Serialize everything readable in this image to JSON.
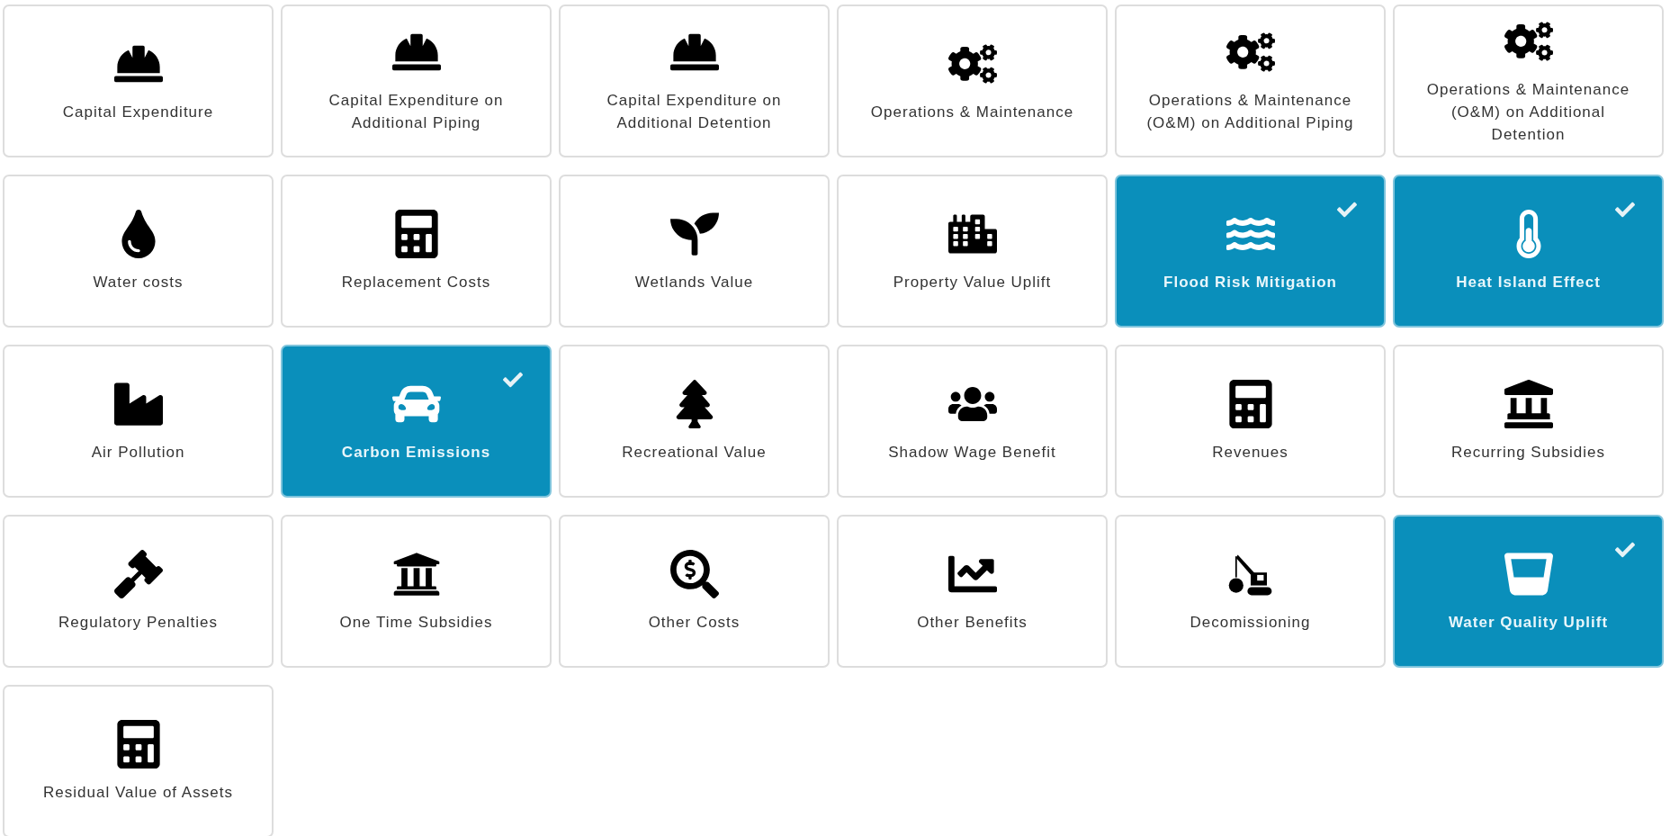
{
  "tiles": [
    {
      "label": "Capital Expenditure",
      "kind": "worker",
      "selected": false
    },
    {
      "label": "Capital Expenditure on Additional Piping",
      "kind": "worker",
      "selected": false
    },
    {
      "label": "Capital Expenditure on Additional Detention",
      "kind": "worker",
      "selected": false
    },
    {
      "label": "Operations & Maintenance",
      "kind": "maintenance",
      "selected": false
    },
    {
      "label": "Operations & Maintenance (O&M) on Additional Piping",
      "kind": "maintenance",
      "selected": false
    },
    {
      "label": "Operations & Maintenance (O&M) on Additional Detention",
      "kind": "maintenance",
      "selected": false
    },
    {
      "label": "Water costs",
      "kind": "drop",
      "selected": false
    },
    {
      "label": "Replacement Costs",
      "kind": "calculator",
      "selected": false
    },
    {
      "label": "Wetlands Value",
      "kind": "wetland",
      "selected": false
    },
    {
      "label": "Property Value Uplift",
      "kind": "buildings",
      "selected": false
    },
    {
      "label": "Flood Risk Mitigation",
      "kind": "flood",
      "selected": true
    },
    {
      "label": "Heat Island Effect",
      "kind": "thermometer",
      "selected": true
    },
    {
      "label": "Air Pollution",
      "kind": "factory",
      "selected": false
    },
    {
      "label": "Carbon Emissions",
      "kind": "car",
      "selected": true
    },
    {
      "label": "Recreational Value",
      "kind": "park",
      "selected": false
    },
    {
      "label": "Shadow Wage Benefit",
      "kind": "people",
      "selected": false
    },
    {
      "label": "Revenues",
      "kind": "calculator",
      "selected": false
    },
    {
      "label": "Recurring Subsidies",
      "kind": "landmark",
      "selected": false
    },
    {
      "label": "Regulatory Penalties",
      "kind": "gavel",
      "selected": false
    },
    {
      "label": "One Time Subsidies",
      "kind": "bank",
      "selected": false
    },
    {
      "label": "Other Costs",
      "kind": "costs",
      "selected": false
    },
    {
      "label": "Other Benefits",
      "kind": "chart",
      "selected": false
    },
    {
      "label": "Decomissioning",
      "kind": "crane",
      "selected": false
    },
    {
      "label": "Water Quality Uplift",
      "kind": "glass",
      "selected": true
    },
    {
      "label": "Residual Value of Assets",
      "kind": "calculator",
      "selected": false
    }
  ]
}
